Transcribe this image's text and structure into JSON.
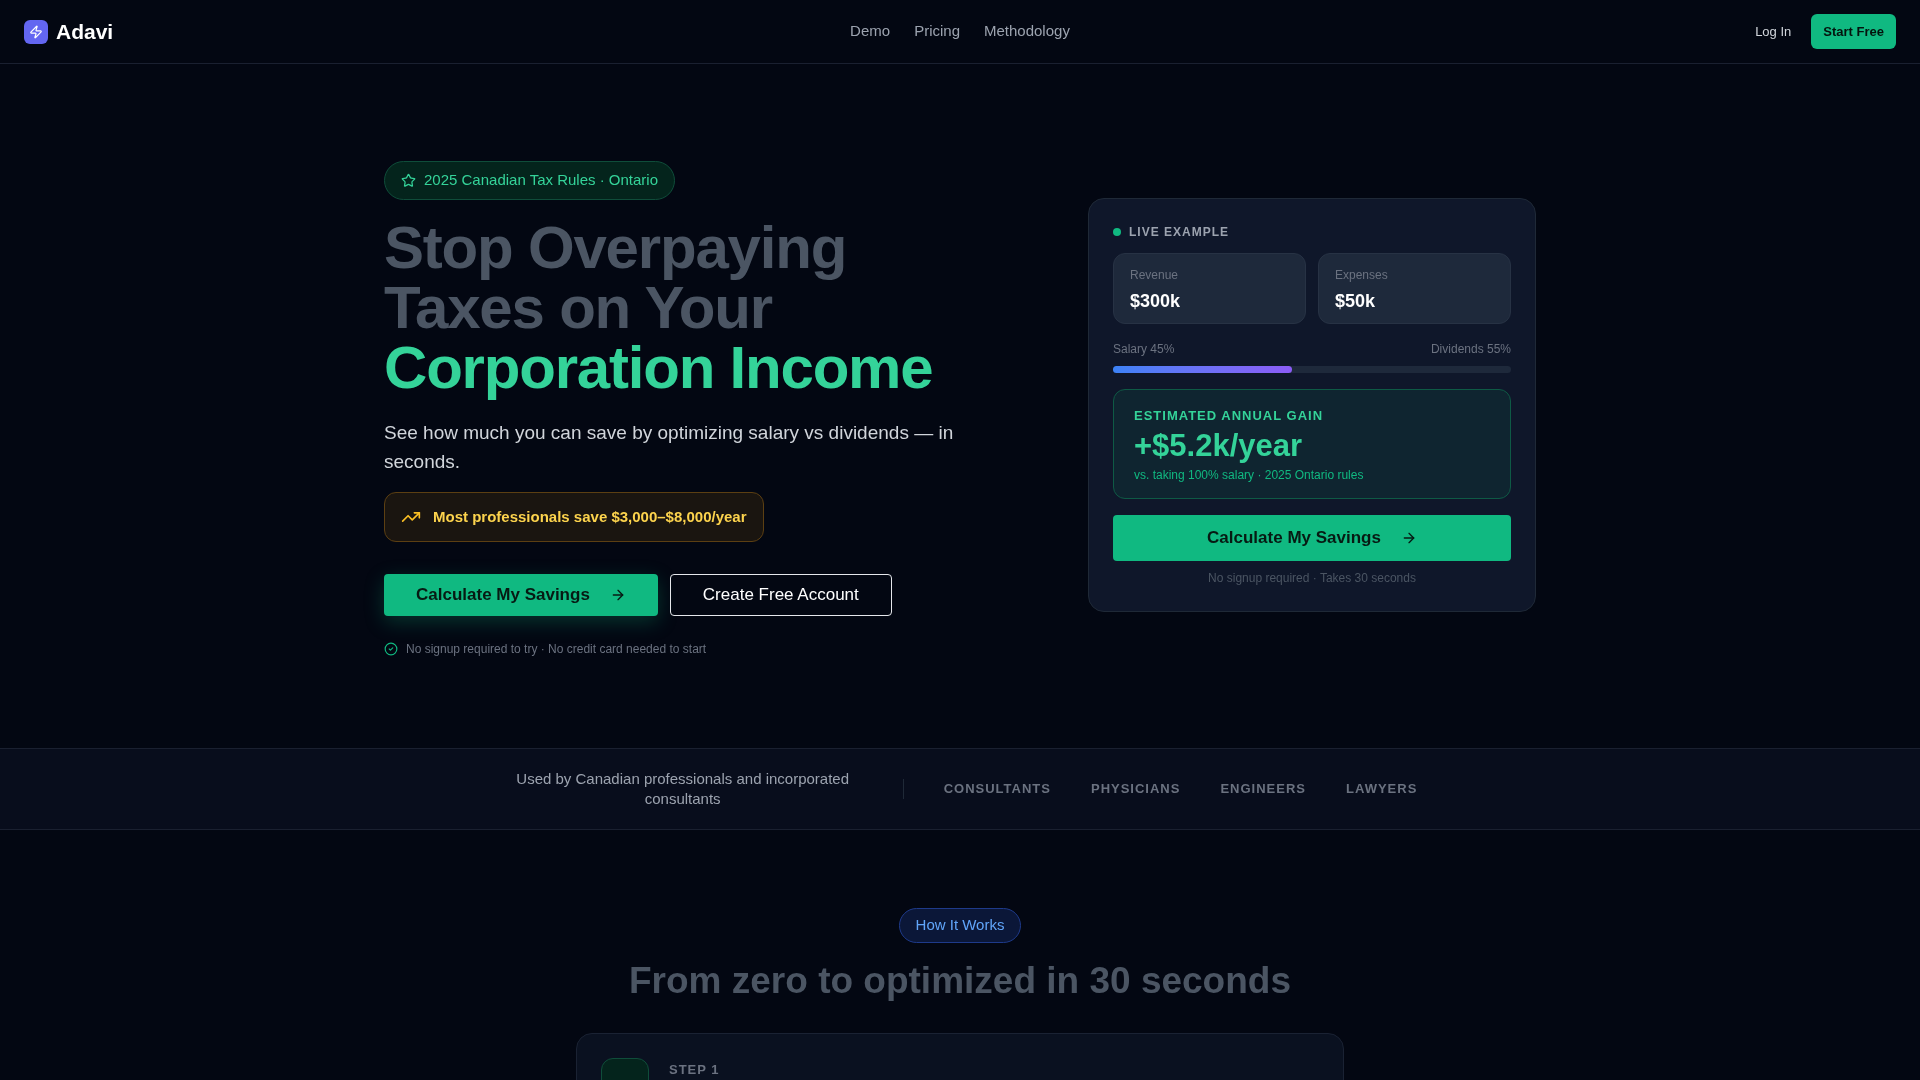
{
  "header": {
    "logo": "Adavi",
    "nav": [
      "Demo",
      "Pricing",
      "Methodology"
    ],
    "login": "Log In",
    "cta": "Start Free"
  },
  "hero": {
    "badge": "2025 Canadian Tax Rules · Ontario",
    "title_lines": [
      "Stop Overpaying",
      "Taxes on Your"
    ],
    "title_highlight": "Corporation Income",
    "subtitle": "See how much you can save by optimizing salary vs dividends — in seconds.",
    "callout": "Most professionals save $3,000–$8,000/year",
    "primary_button": "Calculate My Savings",
    "secondary_button": "Create Free Account",
    "note": "No signup required to try · No credit card needed to start"
  },
  "example_card": {
    "label": "LIVE EXAMPLE",
    "stats": [
      {
        "label": "Revenue",
        "value": "$300k"
      },
      {
        "label": "Expenses",
        "value": "$50k"
      }
    ],
    "split_left": "Salary 45%",
    "split_right": "Dividends 55%",
    "level": 0.45,
    "gain_label": "ESTIMATED ANNUAL GAIN",
    "gain_value": "+$5.2k/year",
    "gain_note": "vs. taking 100% salary · 2025 Ontario rules",
    "button": "Calculate My Savings",
    "footnote": "No signup required · Takes 30 seconds"
  },
  "trust_band": {
    "text": "Used by Canadian professionals and incorporated consultants",
    "professions": [
      "CONSULTANTS",
      "PHYSICIANS",
      "ENGINEERS",
      "LAWYERS"
    ]
  },
  "how_it_works": {
    "badge": "How It Works",
    "title": "From zero to optimized in 30 seconds",
    "step_label": "STEP 1"
  }
}
